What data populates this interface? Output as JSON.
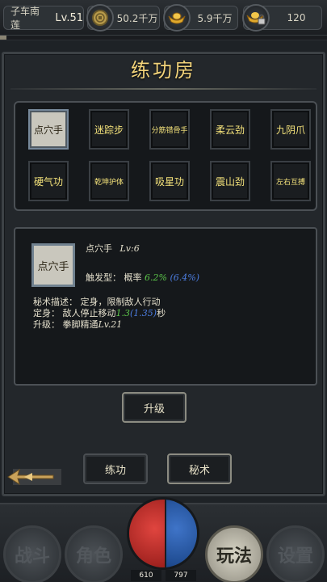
{
  "topbar": {
    "player_name": "子车南莲",
    "player_level": "Lv.51",
    "coins": "50.2千万",
    "gold": "5.9千万",
    "keys": "120"
  },
  "panel": {
    "title": "练功房",
    "skills": [
      {
        "label": "点穴手",
        "selected": true
      },
      {
        "label": "迷踪步"
      },
      {
        "label": "分筋错骨手",
        "small": true
      },
      {
        "label": "柔云劲"
      },
      {
        "label": "九阴爪"
      },
      {
        "label": "硬气功"
      },
      {
        "label": "乾坤护体",
        "small": true
      },
      {
        "label": "吸星功"
      },
      {
        "label": "震山劲"
      },
      {
        "label": "左右互搏",
        "small": true
      }
    ],
    "detail": {
      "icon_label": "点穴手",
      "name": "点穴手",
      "level": "Lv:6",
      "trigger_label": "触发型：",
      "trigger_prob": "概率",
      "trigger_pct": "6.2%",
      "trigger_pct_next": "(6.4%)",
      "desc_line1": "秘术描述：  定身，限制敌人行动",
      "desc_line2_prefix": "定身：  敌人停止移动",
      "desc_line2_val": "1.3",
      "desc_line2_next": "(1.35)",
      "desc_line2_suffix": "秒",
      "desc_line3_prefix": "升级：  拳脚精通",
      "desc_line3_lv": "Lv.21"
    },
    "buttons": {
      "upgrade": "升级",
      "train": "练功",
      "secret": "秘术"
    }
  },
  "bottom": {
    "nav_battle": "战斗",
    "nav_role": "角色",
    "nav_play": "玩法",
    "nav_settings": "设置",
    "hp": "610",
    "mp": "797"
  },
  "colors": {
    "title_gold": "#f2d37a",
    "skill_text": "#f4e27a",
    "green_value": "#5cc64a",
    "blue_value": "#4c7de0"
  }
}
